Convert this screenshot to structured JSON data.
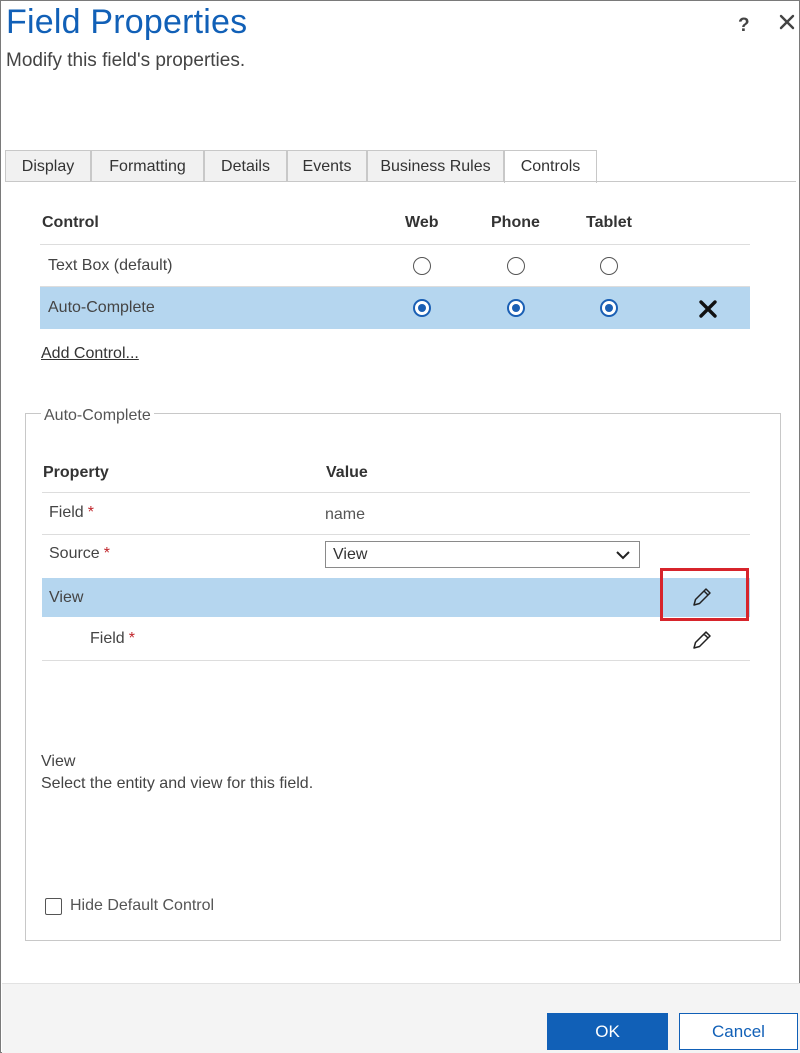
{
  "dialog": {
    "title": "Field Properties",
    "subtitle": "Modify this field's properties.",
    "help_label": "?"
  },
  "tabs": [
    {
      "label": "Display",
      "active": false
    },
    {
      "label": "Formatting",
      "active": false
    },
    {
      "label": "Details",
      "active": false
    },
    {
      "label": "Events",
      "active": false
    },
    {
      "label": "Business Rules",
      "active": false
    },
    {
      "label": "Controls",
      "active": true
    }
  ],
  "controls_table": {
    "headers": {
      "control": "Control",
      "web": "Web",
      "phone": "Phone",
      "tablet": "Tablet"
    },
    "rows": [
      {
        "name": "Text Box (default)",
        "web": false,
        "phone": false,
        "tablet": false
      },
      {
        "name": "Auto-Complete",
        "web": true,
        "phone": true,
        "tablet": true,
        "selected": true
      }
    ],
    "add_link": "Add Control..."
  },
  "group": {
    "legend": "Auto-Complete",
    "headers": {
      "property": "Property",
      "value": "Value"
    },
    "rows": {
      "field": {
        "name": "Field",
        "required": "*",
        "value": "name"
      },
      "source": {
        "name": "Source",
        "required": "*",
        "value": "View"
      },
      "view": {
        "name": "View"
      },
      "subfield": {
        "name": "Field",
        "required": "*"
      }
    },
    "description": {
      "title": "View",
      "text": "Select the entity and view for this field."
    },
    "hide_default": {
      "label": "Hide Default Control",
      "checked": false
    }
  },
  "footer": {
    "ok_label": "OK",
    "cancel_label": "Cancel"
  },
  "colors": {
    "brand_blue": "#1160b7",
    "selected_row": "#b5d6ef",
    "required_red": "#c0242a",
    "highlight_red": "#d7242b"
  },
  "icons": {
    "close": "close-icon",
    "remove": "remove-x-icon",
    "edit": "pencil-icon",
    "dropdown": "chevron-down-icon"
  }
}
